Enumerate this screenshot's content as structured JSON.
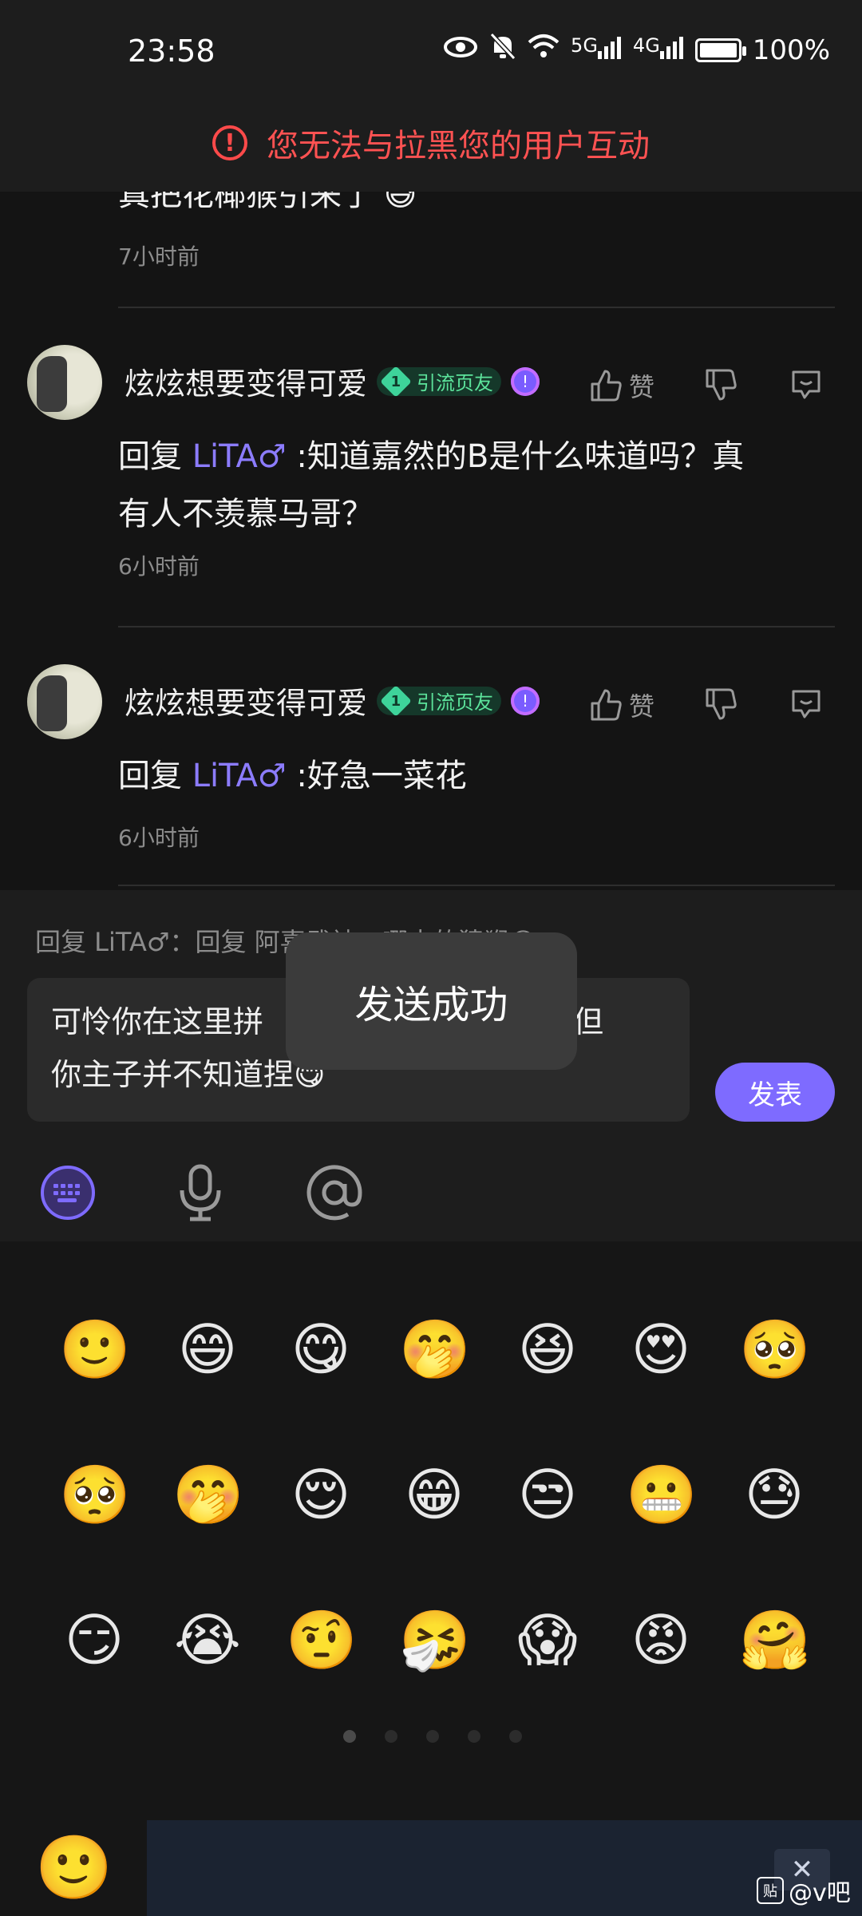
{
  "status_bar": {
    "time": "23:58",
    "network_5g": "5G",
    "network_4g": "4G",
    "battery": "100%"
  },
  "banner": {
    "text": "您无法与拉黑您的用户互动"
  },
  "comments": {
    "partial_text": "真把花椰猴引来了",
    "partial_time": "7小时前",
    "items": [
      {
        "username": "炫炫想要变得可爱",
        "badge_level": "1",
        "badge_text": "引流页友",
        "like_label": "赞",
        "reply_prefix": "回复",
        "mention": "LiTA♂",
        "text_line1": ":知道嘉然的B是什么味道吗？真",
        "text_line2": "有人不羡慕马哥？",
        "time": "6小时前"
      },
      {
        "username": "炫炫想要变得可爱",
        "badge_level": "1",
        "badge_text": "引流页友",
        "like_label": "赞",
        "reply_prefix": "回复",
        "mention": "LiTA♂",
        "text_line1": ":好急一菜花",
        "time": "6小时前"
      }
    ]
  },
  "reply": {
    "reference": "回复 LiTA♂：回复 阿喜武神：哪来的猿猴😏",
    "input_line1": "可怜你在这里拼",
    "input_line1_end": "z，但",
    "input_line2": "你主子并不知道捏😋",
    "send_label": "发表"
  },
  "toast": {
    "text": "发送成功"
  },
  "emoji_rows": [
    [
      "🙂",
      "😄",
      "😋",
      "🤭",
      "😆",
      "😍",
      "🥺"
    ],
    [
      "🥺",
      "🤭",
      "😌",
      "😁",
      "😒",
      "😬",
      "😓"
    ],
    [
      "😏",
      "😭",
      "🤨",
      "🤧",
      "😱",
      "😡",
      "🤗"
    ]
  ],
  "page_dots": {
    "count": 5,
    "active": 0
  },
  "bottom": {
    "emoji_tab": "🙂",
    "delete_label": "✕",
    "watermark_icon": "贴",
    "watermark_text": "@v吧"
  },
  "colors": {
    "accent": "#7e6bff",
    "warning": "#ff5252",
    "badge": "#5ce39b"
  }
}
